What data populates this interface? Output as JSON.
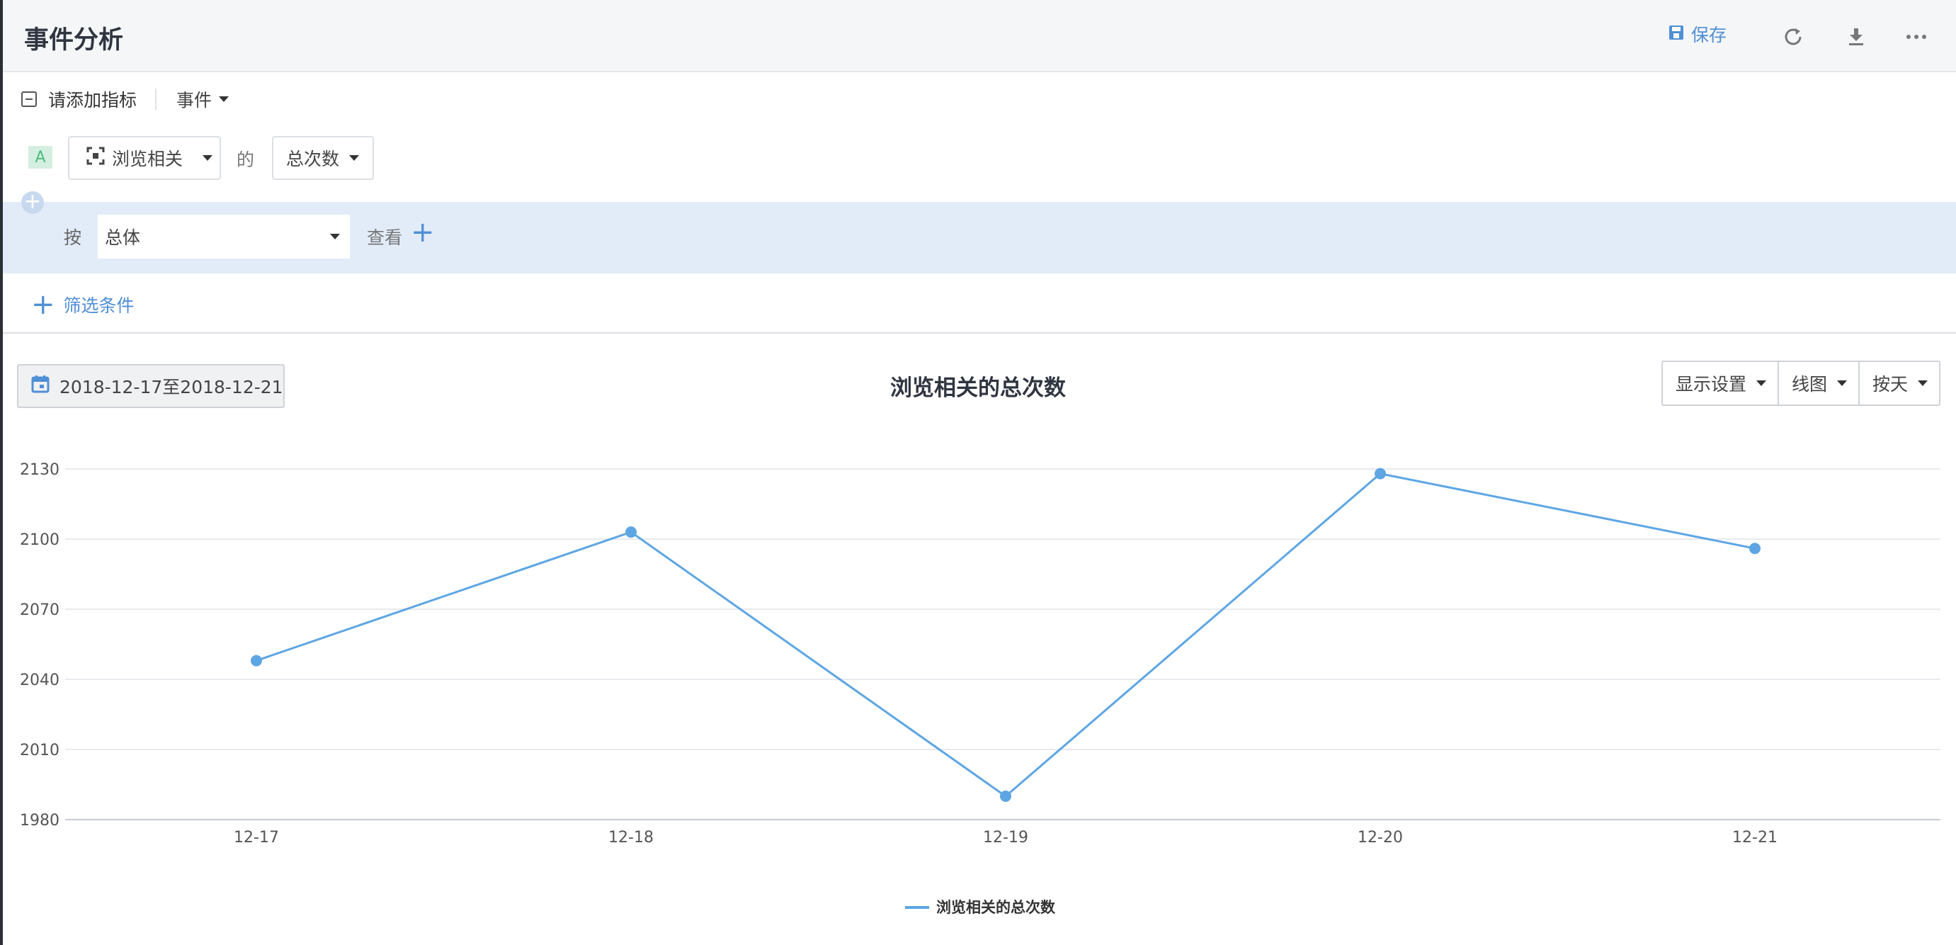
{
  "header": {
    "title": "事件分析",
    "save_label": "保存",
    "icons": [
      "save-icon",
      "refresh-icon",
      "download-icon",
      "more-icon"
    ]
  },
  "metric": {
    "add_metric_label": "请添加指标",
    "event_dropdown_label": "事件",
    "badge": "A",
    "event_name": "浏览相关",
    "of_label": "的",
    "measure": "总次数"
  },
  "group_by": {
    "by_label": "按",
    "selected": "总体",
    "view_label": "查看"
  },
  "filter": {
    "add_filter_label": "筛选条件"
  },
  "toolbar": {
    "date_range": "2018-12-17至2018-12-21",
    "display_settings": "显示设置",
    "chart_type": "线图",
    "granularity": "按天"
  },
  "colors": {
    "accent": "#4f8fd6",
    "series": "#5ea6e3",
    "band": "#e2ecf9"
  },
  "chart_data": {
    "type": "line",
    "title": "浏览相关的总次数",
    "categories": [
      "12-17",
      "12-18",
      "12-19",
      "12-20",
      "12-21"
    ],
    "series": [
      {
        "name": "浏览相关的总次数",
        "values": [
          2048,
          2103,
          1990,
          2128,
          2096
        ]
      }
    ],
    "ylim": [
      1980,
      2130
    ],
    "yticks": [
      1980,
      2010,
      2040,
      2070,
      2100,
      2130
    ],
    "grid": true,
    "legend": "bottom-center"
  }
}
